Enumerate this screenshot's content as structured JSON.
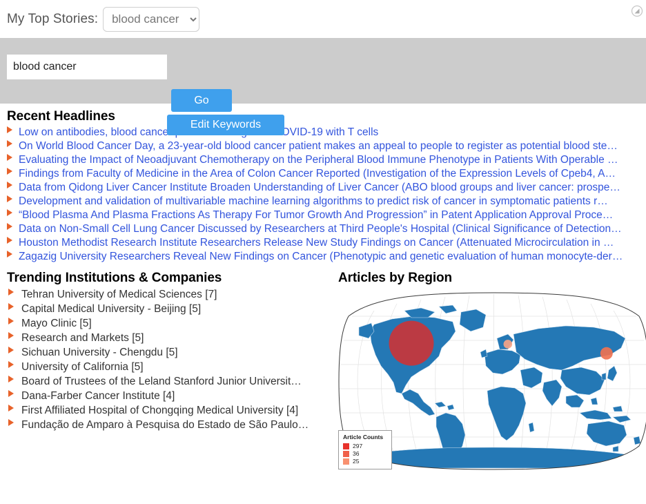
{
  "topbar": {
    "label": "My Top Stories:",
    "selected_story": "blood cancer",
    "options": [
      "blood cancer"
    ],
    "resize_icon": "resize-handle-icon"
  },
  "search": {
    "query_value": "blood cancer",
    "placeholder": "",
    "go_label": "Go",
    "edit_keywords_label": "Edit Keywords",
    "button_color": "#3fa0ed",
    "panel_color": "#cccccc"
  },
  "headlines": {
    "title": "Recent Headlines",
    "link_color": "#3355dd",
    "bullet_color": "#e8622a",
    "items": [
      "Low on antibodies, blood cancer patients can fight off COVID-19 with T cells",
      "On World Blood Cancer Day, a 23-year-old blood cancer patient makes an appeal to people to register as potential blood ste…",
      "Evaluating the Impact of Neoadjuvant Chemotherapy on the Peripheral Blood Immune Phenotype in Patients With Operable …",
      "Findings from Faculty of Medicine in the Area of Colon Cancer Reported (Investigation of the Expression Levels of Cpeb4, A…",
      "Data from Qidong Liver Cancer Institute Broaden Understanding of Liver Cancer (ABO blood groups and liver cancer: prospe…",
      "Development and validation of multivariable machine learning algorithms to predict risk of cancer in symptomatic patients r…",
      "“Blood Plasma And Plasma Fractions As Therapy For Tumor Growth And Progression” in Patent Application Approval Proce…",
      "Data on Non-Small Cell Lung Cancer Discussed by Researchers at Third People's Hospital (Clinical Significance of Detection…",
      "Houston Methodist Research Institute Researchers Release New Study Findings on Cancer (Attenuated Microcirculation in …",
      "Zagazig University Researchers Reveal New Findings on Cancer (Phenotypic and genetic evaluation of human monocyte-der…"
    ]
  },
  "institutions": {
    "title": "Trending Institutions & Companies",
    "items": [
      "Tehran University of Medical Sciences [7]",
      "Capital Medical University - Beijing [5]",
      "Mayo Clinic [5]",
      "Research and Markets [5]",
      "Sichuan University - Chengdu [5]",
      "University of California [5]",
      "Board of Trustees of the Leland Stanford Junior Universit…",
      "Dana-Farber Cancer Institute [4]",
      "First Affiliated Hospital of Chongqing Medical University [4]",
      "Fundação de Amparo à Pesquisa do Estado de São Paulo…"
    ]
  },
  "map": {
    "title": "Articles by Region",
    "land_color": "#2478b5",
    "legend": {
      "title": "Article Counts",
      "entries": [
        {
          "value": "297",
          "color": "#e8322c"
        },
        {
          "value": "36",
          "color": "#f0604a"
        },
        {
          "value": "25",
          "color": "#f89170"
        }
      ]
    }
  },
  "chart_data": {
    "type": "map",
    "title": "Articles by Region",
    "legend_title": "Article Counts",
    "projection": "robinson",
    "bubbles": [
      {
        "region": "United States",
        "value": 297,
        "color": "#c9353a",
        "cx": 0.235,
        "cy": 0.295,
        "r": 0.072
      },
      {
        "region": "Japan",
        "value": 36,
        "color": "#ef7352",
        "cx": 0.862,
        "cy": 0.35,
        "r": 0.02
      },
      {
        "region": "Italy",
        "value": 25,
        "color": "#f6a487",
        "cx": 0.545,
        "cy": 0.3,
        "r": 0.014
      }
    ],
    "legend_entries": [
      {
        "label": "297",
        "color": "#e8322c"
      },
      {
        "label": "36",
        "color": "#f0604a"
      },
      {
        "label": "25",
        "color": "#f89170"
      }
    ]
  }
}
